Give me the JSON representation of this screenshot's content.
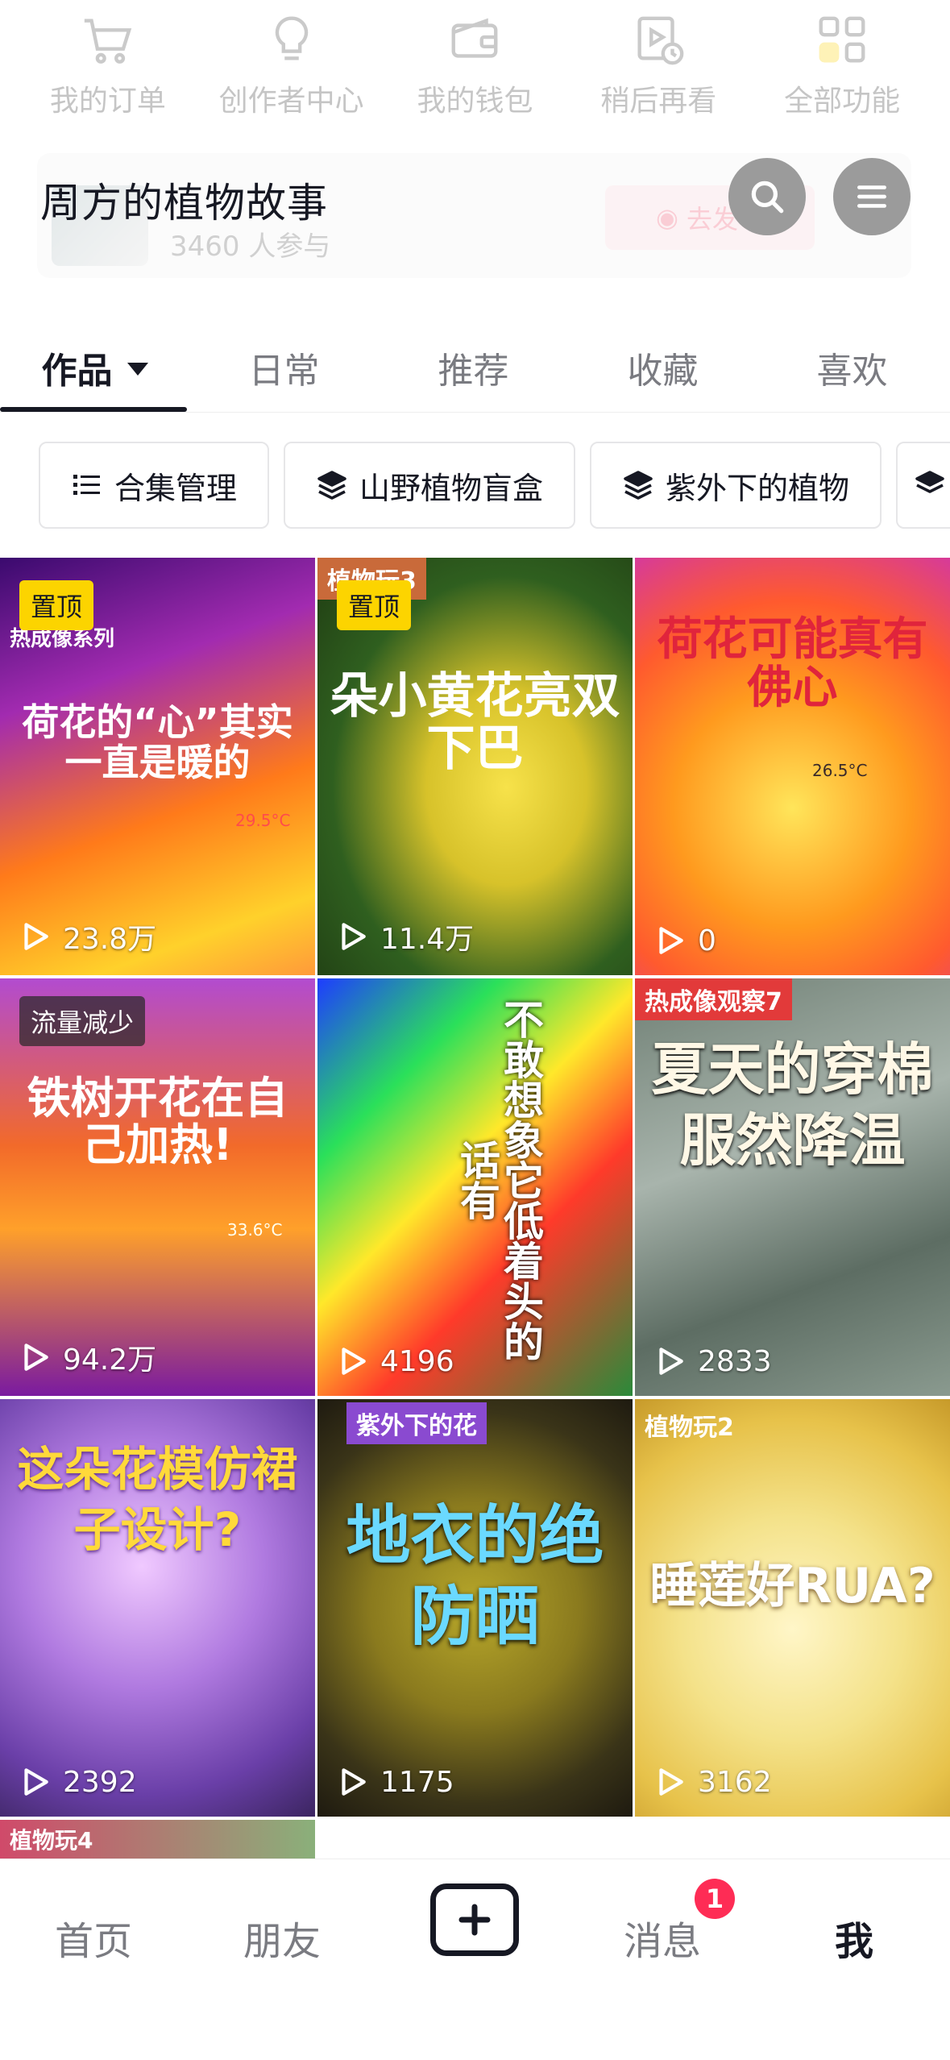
{
  "quick_actions": [
    {
      "label": "我的订单",
      "icon": "cart-icon"
    },
    {
      "label": "创作者中心",
      "icon": "lightbulb-icon"
    },
    {
      "label": "我的钱包",
      "icon": "wallet-icon"
    },
    {
      "label": "稍后再看",
      "icon": "watch-later-icon"
    },
    {
      "label": "全部功能",
      "icon": "grid-icon"
    }
  ],
  "circle": {
    "count": "3460 人参与",
    "button": "去发布"
  },
  "header": {
    "title": "周方的植物故事"
  },
  "tabs": [
    "作品",
    "日常",
    "推荐",
    "收藏",
    "喜欢"
  ],
  "chips": [
    "合集管理",
    "山野植物盲盒",
    "紫外下的植物"
  ],
  "videos": [
    {
      "badge": "置顶",
      "series": "热成像系列",
      "caption": "荷花的“心”其实一直是暖的",
      "temp": "29.5°C",
      "plays": "23.8万",
      "bg": "linear-gradient(160deg,#3a0a6e 0%,#a22bb0 30%,#ff7a1a 60%,#ffd12b 85%,#ff9a3a 100%)",
      "text_color": "#ffffff"
    },
    {
      "badge": "置顶",
      "series": "植物玩3",
      "caption": "朵小黄花亮双下巴",
      "plays": "11.4万",
      "bg": "radial-gradient(ellipse at 60% 55%,#f7e24a 0%,#d7c22a 30%,#2f5f1f 65%,#1f3b12 100%)",
      "text_color": "#ffffff"
    },
    {
      "badge": "",
      "series": "",
      "caption": "荷花可能真有佛心",
      "temp": "26.5°C",
      "plays": "0",
      "bg": "radial-gradient(circle at 50% 60%,#ffe55a 0%,#ff9a1e 40%,#ff5a2e 70%,#d63a9a 100%)",
      "text_color": "#e0243c"
    },
    {
      "badge": "流量减少",
      "series": "",
      "caption": "铁树开花在自己加热!",
      "temp": "33.6°C",
      "plays": "94.2万",
      "bg": "linear-gradient(180deg,#b24bd0 0%,#f26a2a 40%,#ffa02a 60%,#7a1aa0 100%)",
      "text_color": "#ffffff"
    },
    {
      "badge": "",
      "series": "",
      "caption": "不敢想象它低着头的话有",
      "plays": "4196",
      "bg": "linear-gradient(135deg,#1e3cff 0%,#2ae05a 25%,#ffe82a 45%,#ff3a2a 65%,#2a8a3a 100%)",
      "text_color": "#ffffff"
    },
    {
      "badge": "",
      "series": "热成像观察7",
      "caption": "夏天的穿棉服然降温",
      "plays": "2833",
      "bg": "linear-gradient(160deg,#6f7f74 0%,#a8b4ac 40%,#5d6d63 70%,#8a9a8f 100%)",
      "text_color": "#fff8e6"
    },
    {
      "badge": "",
      "series": "",
      "caption": "这朵花模仿裙子设计?",
      "plays": "2392",
      "bg": "radial-gradient(circle at 45% 40%,#f0c9ff 0%,#b07ae0 40%,#6a3fa8 75%,#3b2560 100%)",
      "text_color": "#ffd93a"
    },
    {
      "badge": "",
      "series": "紫外下的花",
      "caption": "地衣的绝防晒",
      "plays": "1175",
      "bg": "radial-gradient(circle at 50% 50%,#b8a82a 0%,#8a7a1e 40%,#3a3418 75%,#1e1a10 100%)",
      "text_color": "#6ad9ff"
    },
    {
      "badge": "",
      "series": "植物玩2",
      "caption": "睡莲好RUA?",
      "plays": "3162",
      "bg": "radial-gradient(circle at 50% 55%,#fff6c8 0%,#f4e28a 40%,#e7c24a 75%,#c79a2a 100%)",
      "text_color": "#ffffff"
    }
  ],
  "partial_video": {
    "series": "植物玩4"
  },
  "bottom_nav": {
    "items": [
      "首页",
      "朋友",
      "消息",
      "我"
    ],
    "message_badge": "1"
  }
}
